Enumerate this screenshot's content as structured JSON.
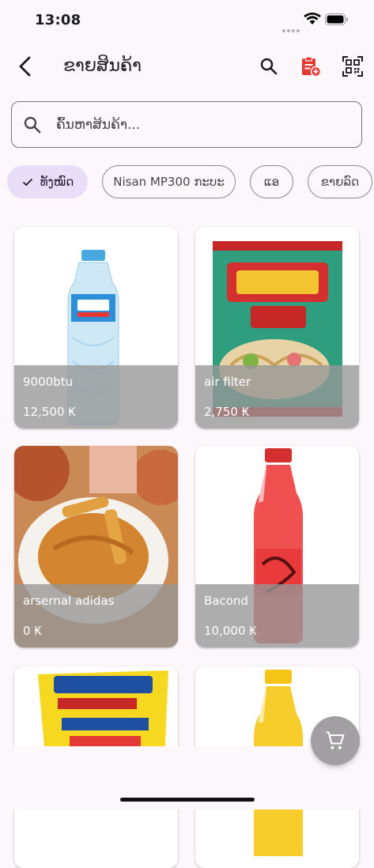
{
  "status_bar": {
    "time": "13:08"
  },
  "header": {
    "title": "ຂາຍສິນຄ້າ"
  },
  "search": {
    "placeholder": "ຄົ້ນຫາສິນຄ້າ..."
  },
  "filters": [
    {
      "label": "ທັງໝົດ",
      "selected": true
    },
    {
      "label": "Nisan MP300 ກະບະ",
      "selected": false
    },
    {
      "label": "ແອ",
      "selected": false
    },
    {
      "label": "ຂາຍລົດ",
      "selected": false
    }
  ],
  "products": [
    {
      "name": "9000btu",
      "price": "12,500 ₭",
      "image": "water-bottle"
    },
    {
      "name": "air filter",
      "price": "2,750 ₭",
      "image": "instant-noodle-pack"
    },
    {
      "name": "arsernal adidas",
      "price": "0 ₭",
      "image": "fried-chicken-plate"
    },
    {
      "name": "Bacond",
      "price": "10,000 ₭",
      "image": "red-soda-bottle"
    },
    {
      "name": "",
      "price": "",
      "image": "snack-bag"
    },
    {
      "name": "",
      "price": "",
      "image": "yellow-drink-bottle"
    }
  ],
  "colors": {
    "accent_chip": "#e8def8",
    "badge_red": "#e53935",
    "fab": "#a29fa3"
  }
}
